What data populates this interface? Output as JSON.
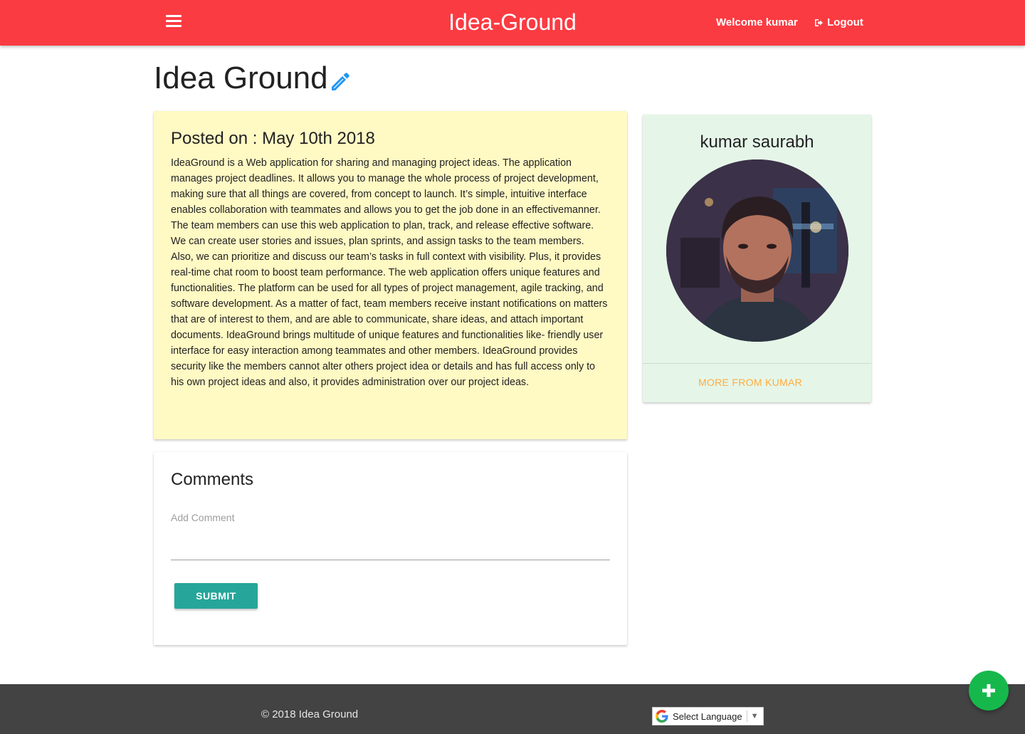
{
  "navbar": {
    "brand": "Idea-Ground",
    "welcome": "Welcome kumar",
    "logout_label": "Logout",
    "background_color": "#fb3b42",
    "menu_icon": "hamburger-menu-icon",
    "logout_icon": "sign-out-icon"
  },
  "page": {
    "title": "Idea Ground",
    "edit_icon": "pencil-edit-icon",
    "edit_icon_color": "#2196f3"
  },
  "idea": {
    "posted_on": "Posted on : May 10th 2018",
    "description": "IdeaGround is a Web application for sharing and managing project ideas. The application manages project deadlines. It allows you to manage the whole process of project development, making sure that all things are covered, from concept to launch. It’s simple, intuitive interface enables collaboration with teammates and allows you to get the job done in an effectivemanner. The team members can use this web application to plan, track, and release effective software. We can create user stories and issues, plan sprints, and assign tasks to the team members. Also, we can prioritize and discuss our team’s tasks in full context with visibility. Plus, it provides real-time chat room to boost team performance. The web application offers unique features and functionalities. The platform can be used for all types of project management, agile tracking, and software development. As a matter of fact, team members receive instant notifications on matters that are of interest to them, and are able to communicate, share ideas, and attach important documents. IdeaGround brings multitude of unique features and functionalities like- friendly user interface for easy interaction among teammates and other members. IdeaGround provides security like the members cannot alter others project idea or details and has full access only to his own project ideas and also, it provides administration over our project ideas.",
    "card_color": "#fff9c4"
  },
  "comments": {
    "title": "Comments",
    "input_label": "Add Comment",
    "input_value": "",
    "submit_label": "SUBMIT",
    "submit_color": "#26a69a"
  },
  "profile": {
    "name": "kumar saurabh",
    "more_link": "MORE FROM KUMAR",
    "card_color": "#e5f6e8",
    "link_color": "#ffab40"
  },
  "footer": {
    "copyright": "© 2018 Idea Ground",
    "language_select": "Select Language",
    "language_arrow": "▼",
    "background_color": "#434343"
  },
  "fab": {
    "icon": "plus-icon",
    "color": "#16b84c"
  }
}
